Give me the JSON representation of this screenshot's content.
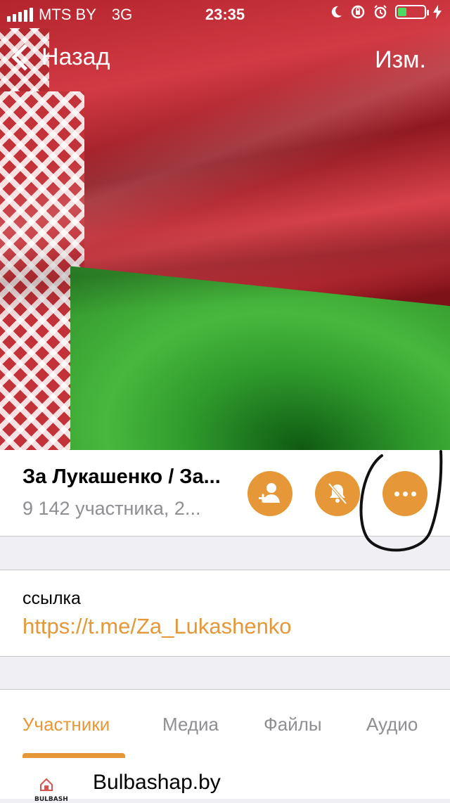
{
  "status_bar": {
    "carrier": "MTS BY",
    "network": "3G",
    "time": "23:35"
  },
  "nav": {
    "back_label": "Назад",
    "edit_label": "Изм."
  },
  "profile": {
    "title": "За Лукашенко / За...",
    "subtitle": "9 142 участника, 2..."
  },
  "link_section": {
    "label": "ссылка",
    "url": "https://t.me/Za_Lukashenko"
  },
  "tabs": [
    {
      "label": "Участники",
      "active": true
    },
    {
      "label": "Медиа",
      "active": false
    },
    {
      "label": "Файлы",
      "active": false
    },
    {
      "label": "Аудио",
      "active": false
    }
  ],
  "members": [
    {
      "name": "Bulbashap.by",
      "avatar_text": "BULBASH"
    }
  ],
  "colors": {
    "accent": "#e69737",
    "secondary_text": "#8e8e93",
    "separator": "#c8c7cc",
    "group_bg": "#efeff4"
  },
  "icons": {
    "add_member": "add-member-icon",
    "mute": "bell-slash-icon",
    "more": "more-dots-icon"
  }
}
